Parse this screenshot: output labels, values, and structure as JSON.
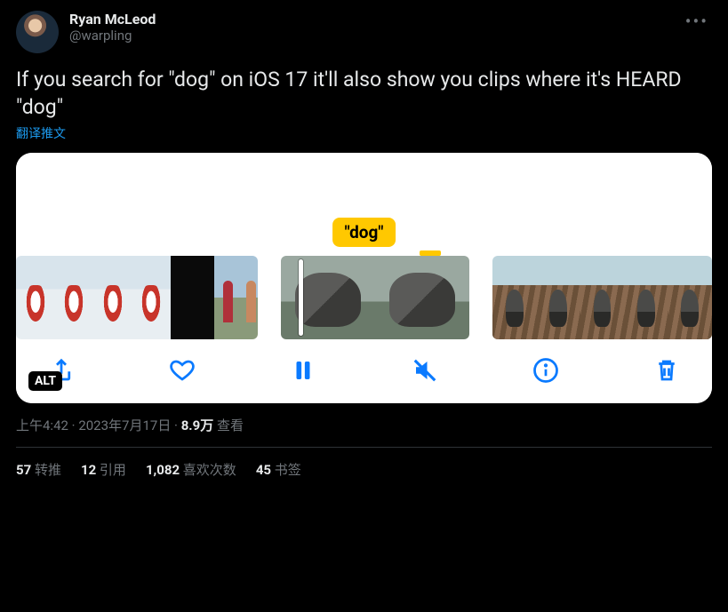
{
  "author": {
    "display_name": "Ryan McLeod",
    "handle": "@warpling"
  },
  "tweet_text": "If you search for \"dog\" on iOS 17 it'll also show you clips where it's HEARD \"dog\"",
  "translate_label": "翻译推文",
  "media": {
    "tag_text": "\"dog\"",
    "alt_badge": "ALT",
    "toolbar_icons": [
      "share",
      "heart",
      "pause",
      "mute",
      "info",
      "trash"
    ]
  },
  "meta": {
    "time": "上午4:42",
    "date": "2023年7月17日",
    "views_count": "8.9万",
    "views_label": "查看"
  },
  "stats": {
    "retweets": {
      "count": "57",
      "label": "转推"
    },
    "quotes": {
      "count": "12",
      "label": "引用"
    },
    "likes": {
      "count": "1,082",
      "label": "喜欢次数"
    },
    "bookmarks": {
      "count": "45",
      "label": "书签"
    }
  }
}
